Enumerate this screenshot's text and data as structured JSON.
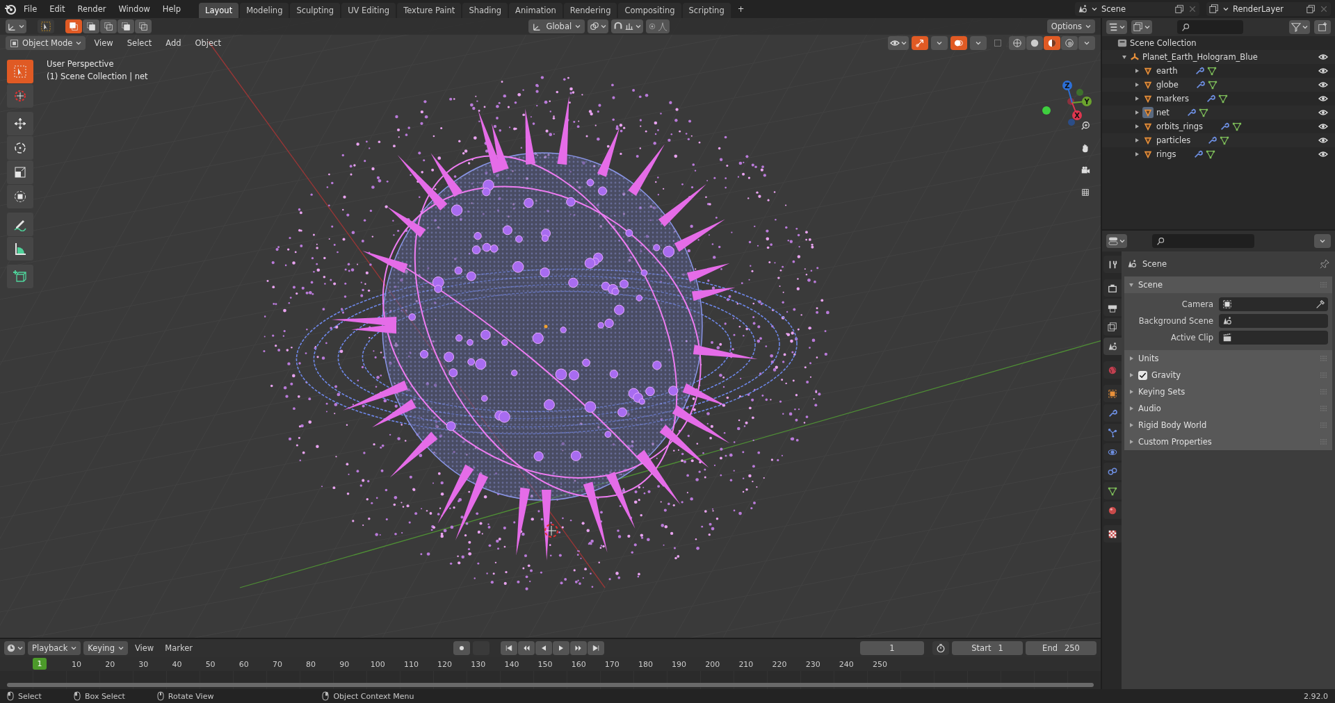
{
  "menu_bar": {
    "items": [
      "File",
      "Edit",
      "Render",
      "Window",
      "Help"
    ]
  },
  "workspaces": [
    {
      "label": "Layout",
      "selected": true
    },
    {
      "label": "Modeling",
      "selected": false
    },
    {
      "label": "Sculpting",
      "selected": false
    },
    {
      "label": "UV Editing",
      "selected": false
    },
    {
      "label": "Texture Paint",
      "selected": false
    },
    {
      "label": "Shading",
      "selected": false
    },
    {
      "label": "Animation",
      "selected": false
    },
    {
      "label": "Rendering",
      "selected": false
    },
    {
      "label": "Compositing",
      "selected": false
    },
    {
      "label": "Scripting",
      "selected": false
    }
  ],
  "add_workspace": "+",
  "scene_selector": {
    "value": "Scene"
  },
  "view_layer_selector": {
    "value": "RenderLayer"
  },
  "tool_header": {
    "orientation": "Global",
    "options": "Options"
  },
  "viewport_header": {
    "mode": "Object Mode",
    "menus": [
      "View",
      "Select",
      "Add",
      "Object"
    ]
  },
  "viewport": {
    "info": [
      "User Perspective",
      "(1) Scene Collection | net"
    ],
    "gizmo_axes": [
      {
        "label": "Z",
        "color": "#2c6fd8"
      },
      {
        "label": "Y",
        "color": "#6ba32e"
      },
      {
        "label": "X",
        "color": "#e0364f"
      }
    ]
  },
  "tool_groups": [
    {
      "tools": [
        {
          "kind": "select",
          "selected": true
        },
        {
          "kind": "cursor",
          "selected": false
        }
      ]
    },
    {
      "tools": [
        {
          "kind": "move",
          "selected": false
        },
        {
          "kind": "rotate",
          "selected": false
        },
        {
          "kind": "scale",
          "selected": false
        },
        {
          "kind": "transform",
          "selected": false
        }
      ]
    },
    {
      "tools": [
        {
          "kind": "annotate",
          "selected": false
        },
        {
          "kind": "measure",
          "selected": false
        }
      ]
    },
    {
      "tools": [
        {
          "kind": "add_cube",
          "selected": false
        }
      ]
    }
  ],
  "outliner": {
    "root": "Scene Collection",
    "collection": {
      "name": "Planet_Earth_Hologram_Blue",
      "expanded": true,
      "children": [
        {
          "name": "earth",
          "selected": false
        },
        {
          "name": "globe",
          "selected": false
        },
        {
          "name": "markers",
          "selected": false
        },
        {
          "name": "net",
          "selected": true
        },
        {
          "name": "orbits_rings",
          "selected": false
        },
        {
          "name": "particles",
          "selected": false
        },
        {
          "name": "rings",
          "selected": false
        }
      ]
    }
  },
  "properties": {
    "tabs": [
      {
        "kind": "tool",
        "selected": false
      },
      {
        "kind": "render",
        "selected": false
      },
      {
        "kind": "output",
        "selected": false
      },
      {
        "kind": "view_layer",
        "selected": false
      },
      {
        "kind": "scene",
        "selected": true
      },
      {
        "kind": "world",
        "selected": false
      },
      {
        "kind": "object",
        "selected": false
      },
      {
        "kind": "modifiers",
        "selected": false
      },
      {
        "kind": "particles",
        "selected": false
      },
      {
        "kind": "physics",
        "selected": false
      },
      {
        "kind": "constraints",
        "selected": false
      },
      {
        "kind": "data",
        "selected": false
      },
      {
        "kind": "material",
        "selected": false
      },
      {
        "kind": "texture",
        "selected": false
      }
    ],
    "context": "Scene",
    "panels": [
      {
        "kind": "plain",
        "title": "Scene",
        "expanded": true,
        "fields": [
          {
            "label": "Camera",
            "kind": "camera"
          },
          {
            "label": "Background Scene",
            "kind": "scene"
          },
          {
            "label": "Active Clip",
            "kind": "clip"
          }
        ]
      },
      {
        "kind": "plain",
        "title": "Units",
        "expanded": false
      },
      {
        "kind": "toggle",
        "title": "Gravity",
        "expanded": false,
        "checked": true
      },
      {
        "kind": "plain",
        "title": "Keying Sets",
        "expanded": false
      },
      {
        "kind": "plain",
        "title": "Audio",
        "expanded": false
      },
      {
        "kind": "plain",
        "title": "Rigid Body World",
        "expanded": false
      },
      {
        "kind": "plain",
        "title": "Custom Properties",
        "expanded": false
      }
    ]
  },
  "timeline": {
    "menus": [
      {
        "label": "Playback",
        "kind": "dropdown"
      },
      {
        "label": "Keying",
        "kind": "dropdown"
      },
      {
        "label": "View",
        "kind": "menu"
      },
      {
        "label": "Marker",
        "kind": "menu"
      }
    ],
    "current_frame": "1",
    "start_label": "Start",
    "start": "1",
    "end_label": "End",
    "end": "250",
    "playhead": "1",
    "ruler": [
      "10",
      "20",
      "30",
      "40",
      "50",
      "60",
      "70",
      "80",
      "90",
      "100",
      "110",
      "120",
      "130",
      "140",
      "150",
      "160",
      "170",
      "180",
      "190",
      "200",
      "210",
      "220",
      "230",
      "240",
      "250"
    ]
  },
  "status_bar": {
    "hints": [
      {
        "label": "Select",
        "kind": "left"
      },
      {
        "label": "Box Select",
        "kind": "drag"
      },
      {
        "label": "Rotate View",
        "kind": "middle"
      },
      {
        "label": "Object Context Menu",
        "kind": "right"
      }
    ],
    "version": "2.92.0"
  }
}
